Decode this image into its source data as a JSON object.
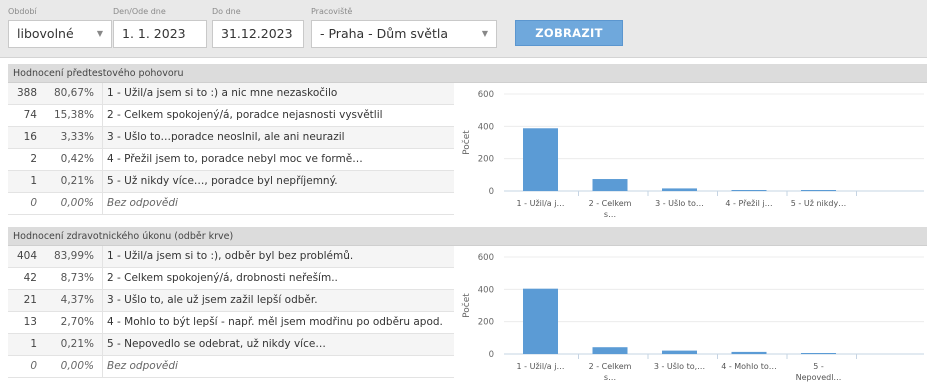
{
  "filters": {
    "obdobi": {
      "label": "Období",
      "value": "libovolné"
    },
    "od": {
      "label": "Den/Ode dne",
      "value": "1. 1. 2023"
    },
    "do": {
      "label": "Do dne",
      "value": "31.12.2023"
    },
    "pracoviste": {
      "label": "Pracoviště",
      "value": "- Praha - Dům světla"
    },
    "button": "ZOBRAZIT"
  },
  "sections": [
    {
      "title": "Hodnocení předtestového pohovoru",
      "rows": [
        {
          "count": "388",
          "pct": "80,67%",
          "label": "1 - Užil/a jsem si to :) a nic mne nezaskočilo"
        },
        {
          "count": "74",
          "pct": "15,38%",
          "label": "2 - Celkem spokojený/á, poradce nejasnosti vysvětlil"
        },
        {
          "count": "16",
          "pct": "3,33%",
          "label": "3 - Ušlo to…poradce neoslnil, ale ani neurazil"
        },
        {
          "count": "2",
          "pct": "0,42%",
          "label": "4 - Přežil jsem to, poradce nebyl moc ve formě…"
        },
        {
          "count": "1",
          "pct": "0,21%",
          "label": "5 - Už nikdy více…, poradce byl nepříjemný."
        },
        {
          "count": "0",
          "pct": "0,00%",
          "label": "Bez odpovědi",
          "na": true
        }
      ]
    },
    {
      "title": "Hodnocení zdravotnického úkonu (odběr krve)",
      "rows": [
        {
          "count": "404",
          "pct": "83,99%",
          "label": "1 - Užil/a jsem si to :), odběr byl bez problémů."
        },
        {
          "count": "42",
          "pct": "8,73%",
          "label": "2 - Celkem spokojený/á, drobnosti neřeším.."
        },
        {
          "count": "21",
          "pct": "4,37%",
          "label": "3 - Ušlo to, ale už jsem zažil lepší odběr."
        },
        {
          "count": "13",
          "pct": "2,70%",
          "label": "4 - Mohlo to být lepší - např. měl jsem modřinu po odběru apod."
        },
        {
          "count": "1",
          "pct": "0,21%",
          "label": "5 - Nepovedlo se odebrat, už nikdy více…"
        },
        {
          "count": "0",
          "pct": "0,00%",
          "label": "Bez odpovědi",
          "na": true
        }
      ]
    }
  ],
  "chart_data": [
    {
      "type": "bar",
      "ylabel": "Počet",
      "ylim": [
        0,
        600
      ],
      "yticks": [
        "0",
        "200",
        "400",
        "600"
      ],
      "categories": [
        [
          "1 - Užil/a j…"
        ],
        [
          "2 - Celkem",
          "s…"
        ],
        [
          "3 - Ušlo to…"
        ],
        [
          "4 - Přežil j…"
        ],
        [
          "5 - Už nikdy…"
        ]
      ],
      "values": [
        388,
        74,
        16,
        2,
        1
      ],
      "color": "#5b9bd5"
    },
    {
      "type": "bar",
      "ylabel": "Počet",
      "ylim": [
        0,
        600
      ],
      "yticks": [
        "0",
        "200",
        "400",
        "600"
      ],
      "categories": [
        [
          "1 - Užil/a j…"
        ],
        [
          "2 - Celkem",
          "s…"
        ],
        [
          "3 - Ušlo to,…"
        ],
        [
          "4 - Mohlo to…"
        ],
        [
          "5 -",
          "Nepovedl…"
        ]
      ],
      "values": [
        404,
        42,
        21,
        13,
        1
      ],
      "color": "#5b9bd5"
    }
  ]
}
